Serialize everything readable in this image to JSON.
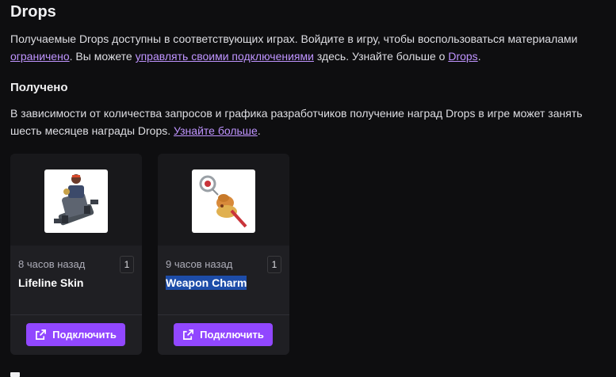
{
  "page": {
    "title": "Drops",
    "intro": {
      "line1": "Получаемые Drops доступны в соответствующих играх. Войдите в игру, чтобы воспользоваться материалами",
      "link_limited": "ограничено",
      "text_after_limited": ". Вы можете ",
      "link_manage": "управлять своими подключениями",
      "text_after_manage": " здесь. Узнайте больше о ",
      "link_drops": "Drops",
      "text_end": "."
    },
    "received": {
      "title": "Получено",
      "line1": "В зависимости от количества запросов и графика разработчиков получение наград Drops в игре может занять",
      "line2_text": "шесть месяцев награды Drops. ",
      "link_learn_more": "Узнайте больше",
      "line2_end": "."
    }
  },
  "cards": [
    {
      "time": "8 часов назад",
      "quantity": "1",
      "name": "Lifeline Skin",
      "button_label": "Подключить",
      "button_icon": "external-link-icon"
    },
    {
      "time": "9 часов назад",
      "quantity": "1",
      "name": "Weapon Charm",
      "button_label": "Подключить",
      "button_icon": "external-link-icon"
    }
  ],
  "colors": {
    "background": "#0e0e10",
    "card": "#1f1f23",
    "accent": "#9147ff",
    "link": "#bf94ff",
    "selection": "#1d4ca8"
  }
}
